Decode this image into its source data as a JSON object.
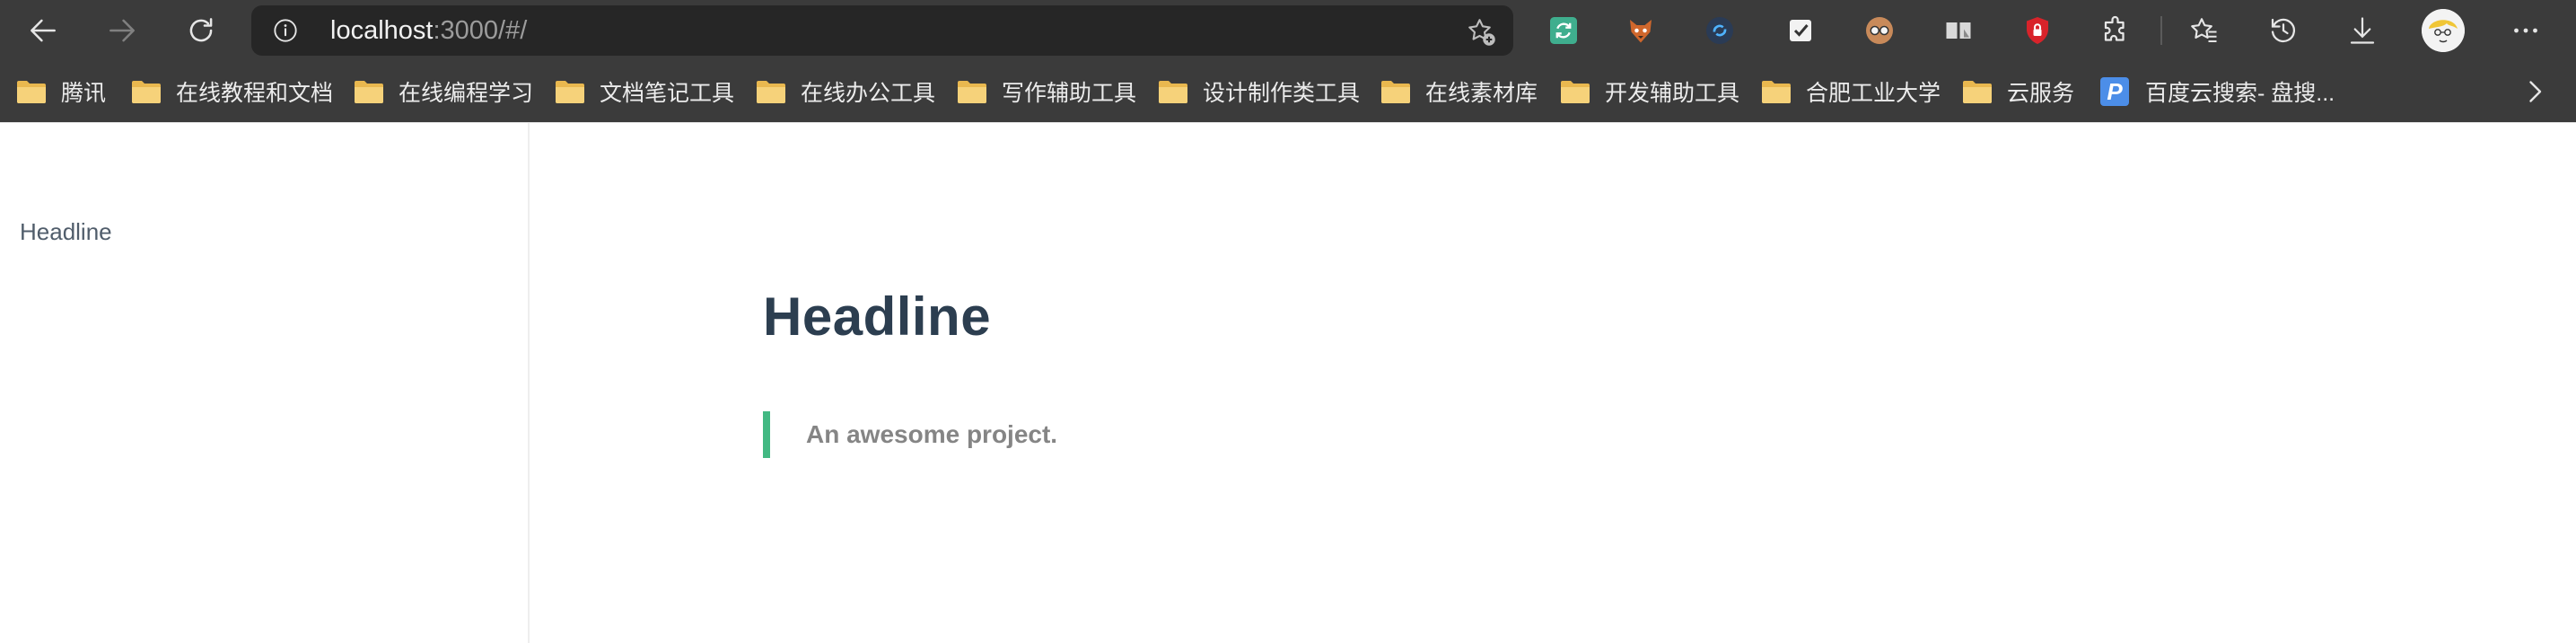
{
  "browser": {
    "nav": {
      "back_icon": "back-arrow-icon",
      "forward_icon": "forward-arrow-icon",
      "reload_icon": "reload-icon"
    },
    "address": {
      "host": "localhost",
      "rest": ":3000/#/"
    },
    "toolbar_icons": [
      "refresh-extension-icon",
      "fox-extension-icon",
      "sync-extension-icon",
      "checkbox-extension-icon",
      "glasses-extension-icon",
      "reader-extension-icon",
      "shield-lock-extension-icon",
      "extensions-puzzle-icon",
      "favorites-icon",
      "history-icon",
      "downloads-icon",
      "profile-avatar",
      "more-menu-icon"
    ],
    "bookmarks": [
      {
        "label": "腾讯"
      },
      {
        "label": "在线教程和文档"
      },
      {
        "label": "在线编程学习"
      },
      {
        "label": "文档笔记工具"
      },
      {
        "label": "在线办公工具"
      },
      {
        "label": "写作辅助工具"
      },
      {
        "label": "设计制作类工具"
      },
      {
        "label": "在线素材库"
      },
      {
        "label": "开发辅助工具"
      },
      {
        "label": "合肥工业大学"
      },
      {
        "label": "云服务"
      }
    ],
    "bookmark_link": {
      "badge": "P",
      "label": "百度云搜索- 盘搜..."
    }
  },
  "sidebar": {
    "items": [
      {
        "label": "Headline"
      }
    ]
  },
  "main": {
    "title": "Headline",
    "quote": "An awesome project."
  },
  "colors": {
    "chrome": "#3b3b3b",
    "omnibox": "#262626",
    "heading": "#2c3e50",
    "accent": "#42b983",
    "quote_text": "#858585",
    "sidebar_text": "#505d6b"
  }
}
